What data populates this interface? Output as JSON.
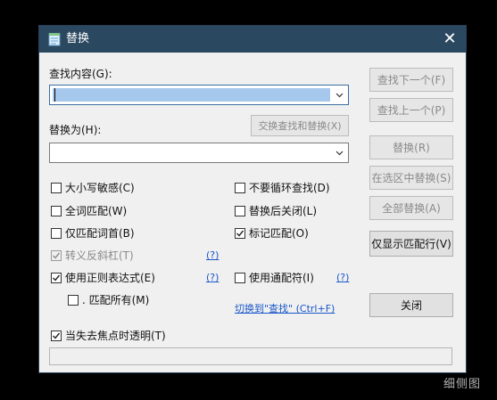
{
  "window": {
    "title": "替换"
  },
  "find": {
    "label": "查找内容(G):",
    "value": ""
  },
  "swap_button": "交换查找和替换(X)",
  "replace": {
    "label": "替换为(H):",
    "value": ""
  },
  "options": {
    "case_sensitive": {
      "label": "大小写敏感(C)",
      "checked": false
    },
    "whole_word": {
      "label": "全词匹配(W)",
      "checked": false
    },
    "word_start": {
      "label": "仅匹配词首(B)",
      "checked": false
    },
    "escape_backslash": {
      "label": "转义反斜杠(T)",
      "checked": true,
      "disabled": true
    },
    "regex": {
      "label": "使用正则表达式(E)",
      "checked": true
    },
    "dot_all": {
      "label": ". 匹配所有(M)",
      "checked": false
    },
    "no_wrap": {
      "label": "不要循环查找(D)",
      "checked": false
    },
    "close_after_replace": {
      "label": "替换后关闭(L)",
      "checked": false
    },
    "mark_matches": {
      "label": "标记匹配(O)",
      "checked": true
    },
    "wildcard": {
      "label": "使用通配符(I)",
      "checked": false
    },
    "transparent_on_blur": {
      "label": "当失去焦点时透明(T)",
      "checked": true
    }
  },
  "help_link": "(?)",
  "switch_link": "切换到\"查找\" (Ctrl+F)",
  "buttons": {
    "find_next": "查找下一个(F)",
    "find_prev": "查找上一个(P)",
    "replace": "替换(R)",
    "replace_in_selection": "在选区中替换(S)",
    "replace_all": "全部替换(A)",
    "show_matching_lines": "仅显示匹配行(V)",
    "close": "关闭"
  },
  "watermark": "细侧图"
}
